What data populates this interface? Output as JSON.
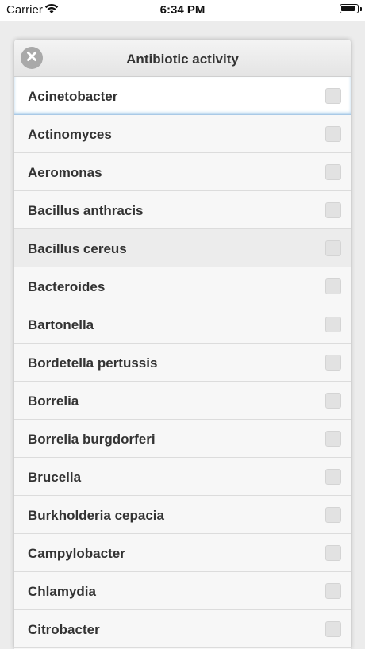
{
  "status_bar": {
    "carrier": "Carrier",
    "time": "6:34 PM",
    "wifi_icon": "wifi-icon",
    "battery_icon": "battery-icon"
  },
  "panel": {
    "title": "Antibiotic activity",
    "close_icon": "close-icon"
  },
  "items": [
    {
      "label": "Acinetobacter",
      "checked": false
    },
    {
      "label": "Actinomyces",
      "checked": false
    },
    {
      "label": "Aeromonas",
      "checked": false
    },
    {
      "label": "Bacillus anthracis",
      "checked": false
    },
    {
      "label": "Bacillus cereus",
      "checked": false
    },
    {
      "label": "Bacteroides",
      "checked": false
    },
    {
      "label": "Bartonella",
      "checked": false
    },
    {
      "label": "Bordetella pertussis",
      "checked": false
    },
    {
      "label": "Borrelia",
      "checked": false
    },
    {
      "label": "Borrelia burgdorferi",
      "checked": false
    },
    {
      "label": "Brucella",
      "checked": false
    },
    {
      "label": "Burkholderia cepacia",
      "checked": false
    },
    {
      "label": "Campylobacter",
      "checked": false
    },
    {
      "label": "Chlamydia",
      "checked": false
    },
    {
      "label": "Citrobacter",
      "checked": false
    }
  ]
}
